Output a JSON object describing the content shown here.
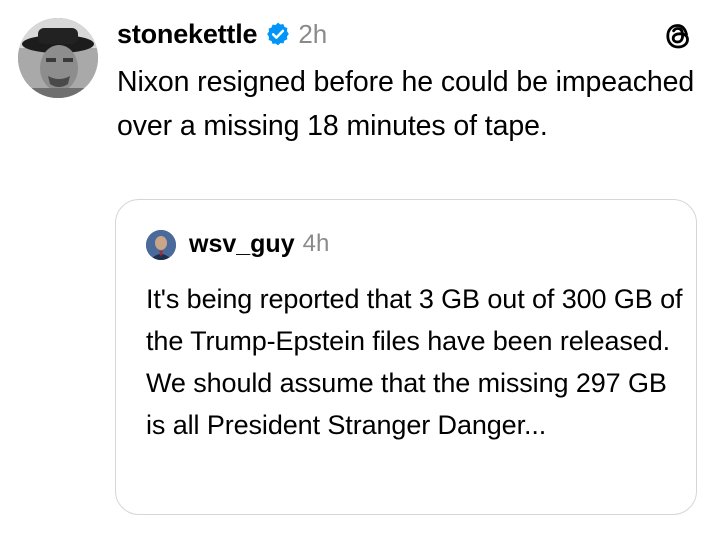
{
  "post": {
    "author": {
      "username": "stonekettle",
      "verified_icon": "verified-badge-icon"
    },
    "timestamp": "2h",
    "text": "Nixon resigned before he could be impeached over a missing 18 minutes of tape.",
    "app_icon": "threads-logo-icon"
  },
  "quoted_post": {
    "author": {
      "username": "wsv_guy"
    },
    "timestamp": "4h",
    "text": "It's being reported that 3 GB out of 300 GB of the Trump-Epstein files have been released. We should assume that the missing 297 GB is all President Stranger Danger..."
  },
  "colors": {
    "verified_blue": "#0095f6",
    "muted_text": "#8a8a8a",
    "card_border": "#d6d6d6"
  }
}
